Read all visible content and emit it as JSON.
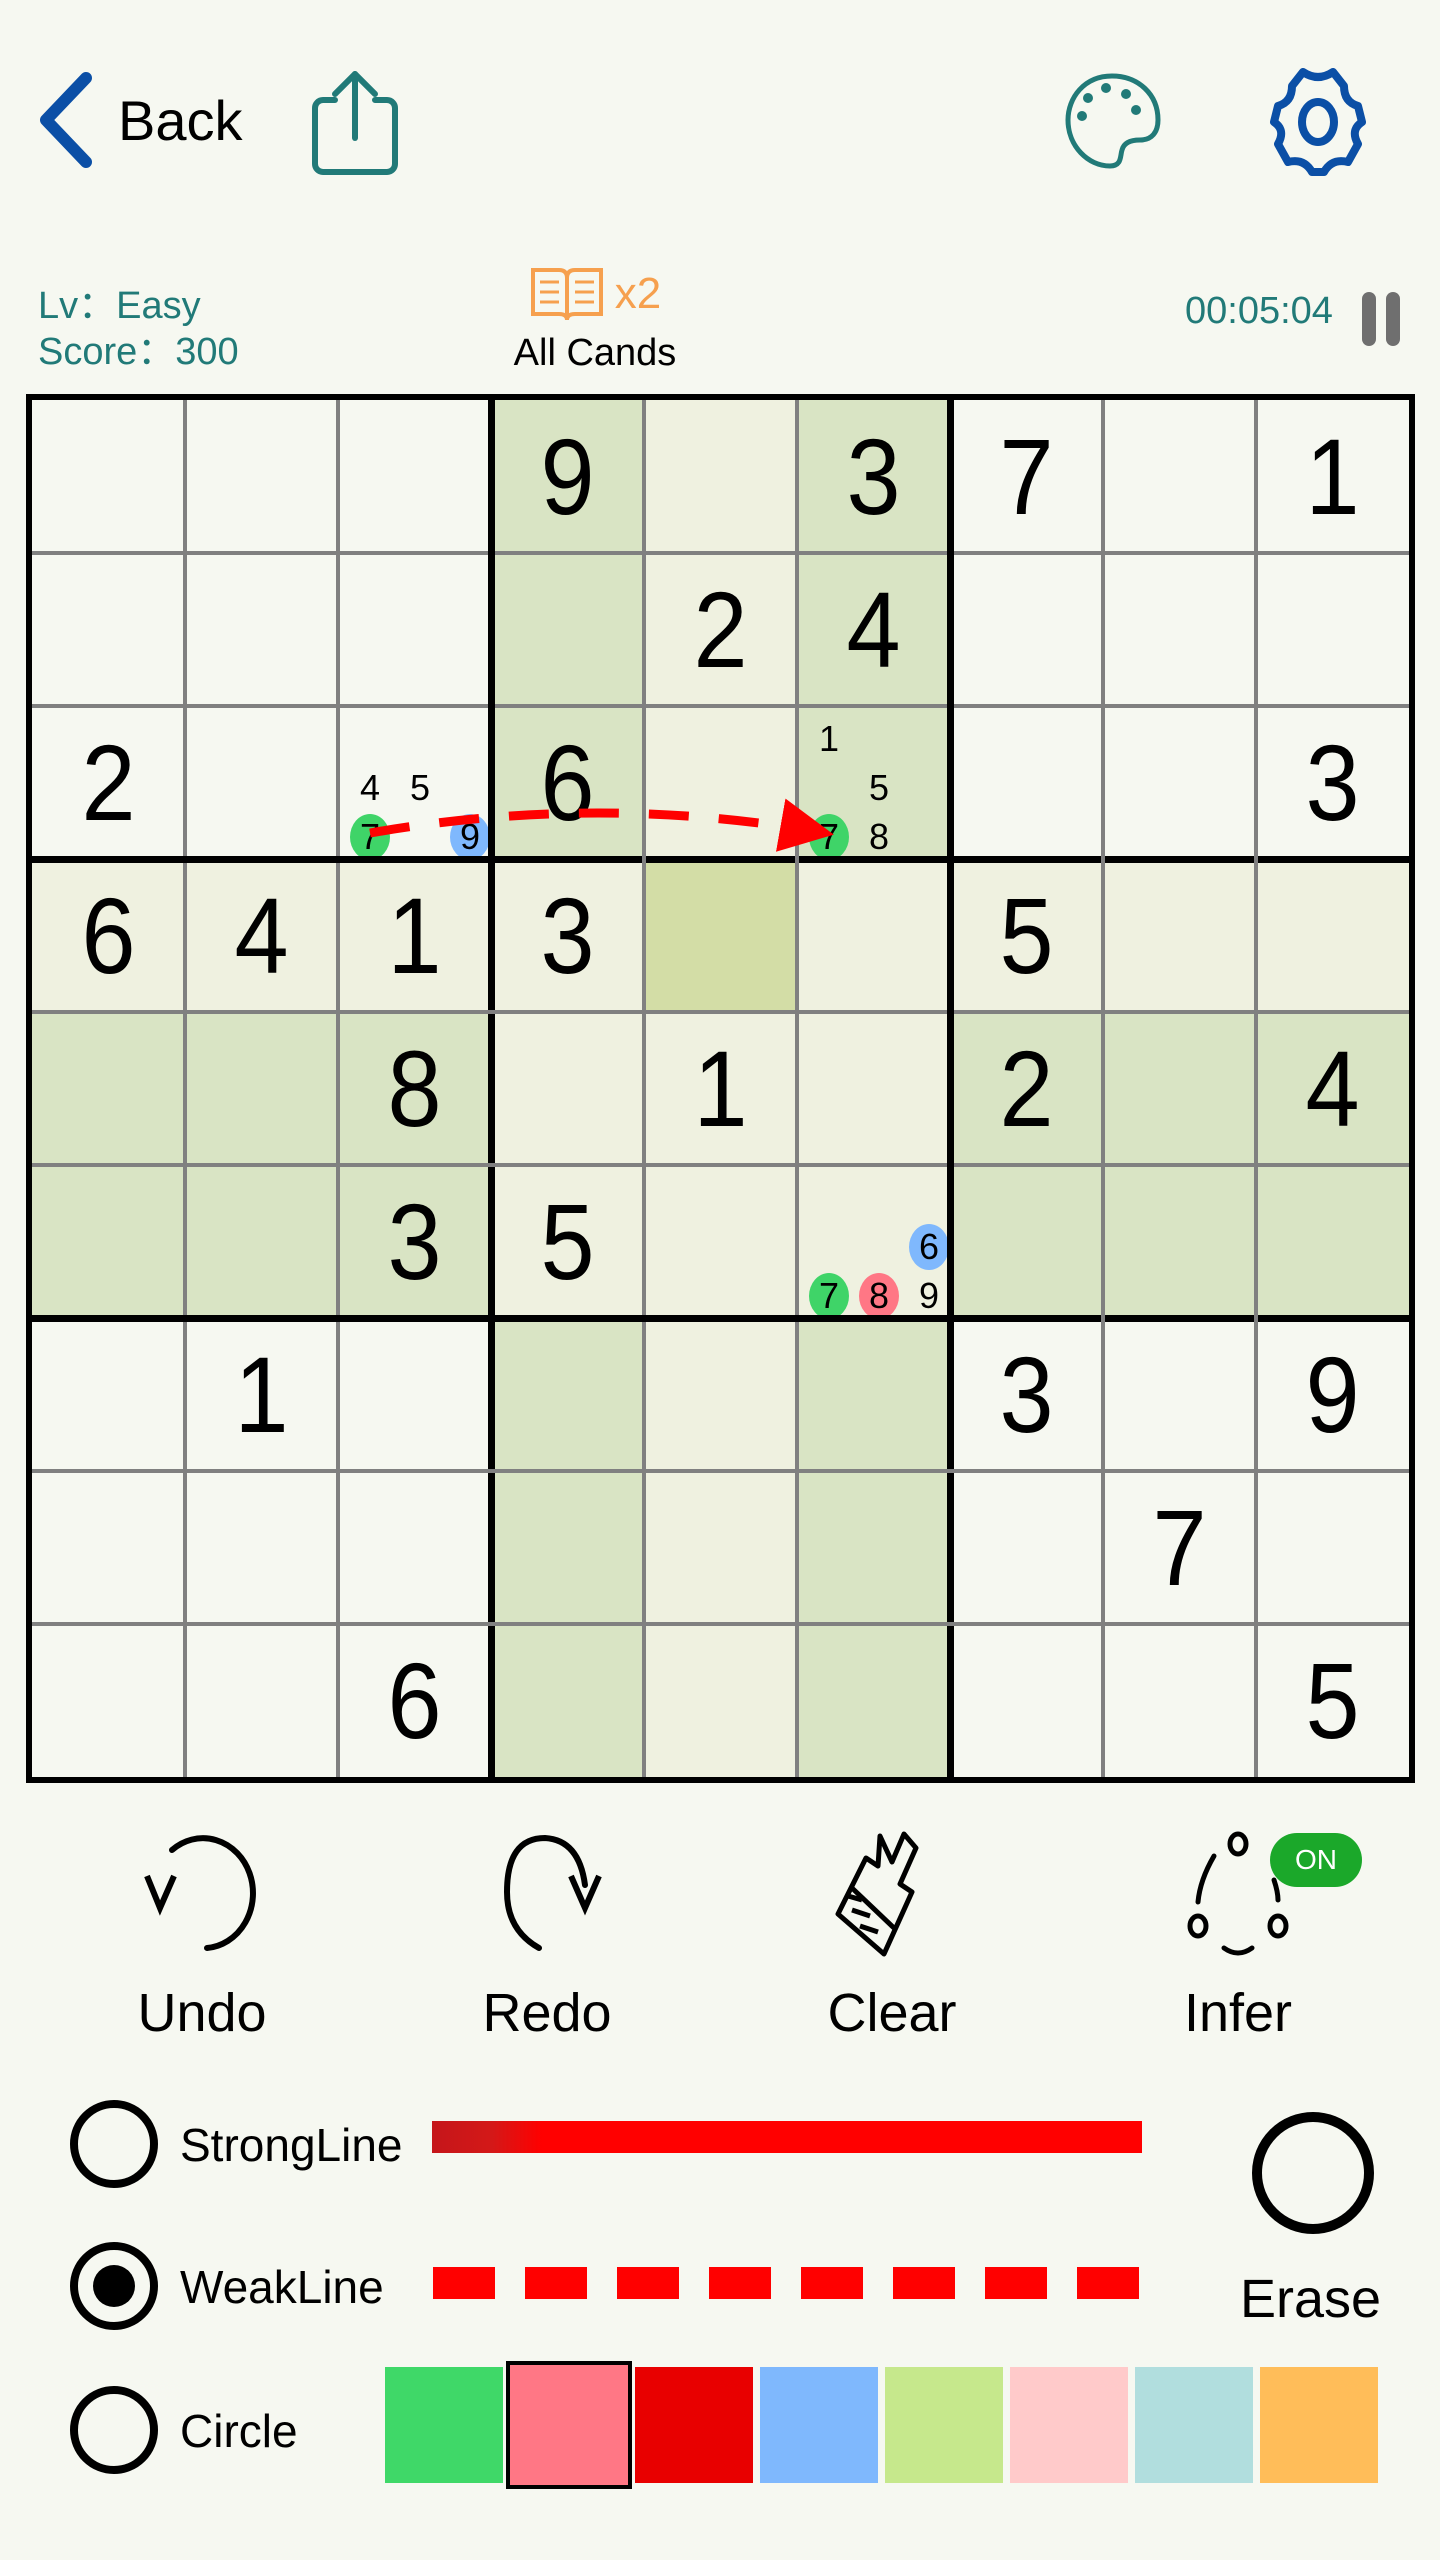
{
  "topbar": {
    "back_label": "Back",
    "icons": [
      "chevron-left-icon",
      "share-icon",
      "palette-icon",
      "gear-icon"
    ]
  },
  "info": {
    "level": "Lv：Easy",
    "score": "Score：300",
    "cands_multiplier": "x2",
    "cands_label": "All Cands",
    "timer": "00:05:04"
  },
  "colors": {
    "accent_teal": "#217a78",
    "accent_blue": "#0b4fa6",
    "cands_orange": "#f6a04e",
    "on_badge": "#1ba82a",
    "line_red": "#ff0000",
    "cell_white": "#f6f8f1",
    "cell_dark": "#d9e4c4",
    "cell_light": "#eff1e0",
    "cell_selected": "#d3dda6"
  },
  "board": {
    "givens": [
      [
        0,
        0,
        0,
        9,
        0,
        3,
        7,
        0,
        1
      ],
      [
        0,
        0,
        0,
        0,
        2,
        4,
        0,
        0,
        0
      ],
      [
        2,
        0,
        0,
        6,
        0,
        0,
        0,
        0,
        3
      ],
      [
        6,
        4,
        1,
        3,
        0,
        0,
        5,
        0,
        0
      ],
      [
        0,
        0,
        8,
        0,
        1,
        0,
        2,
        0,
        4
      ],
      [
        0,
        0,
        3,
        5,
        0,
        0,
        0,
        0,
        0
      ],
      [
        0,
        1,
        0,
        0,
        0,
        0,
        3,
        0,
        9
      ],
      [
        0,
        0,
        0,
        0,
        0,
        0,
        0,
        7,
        0
      ],
      [
        0,
        0,
        6,
        0,
        0,
        0,
        0,
        0,
        5
      ]
    ],
    "shading": [
      "wwwdldwww",
      "wwwdldwww",
      "wwwdldwww",
      "lllllllll",
      "dddllldddd",
      "dddllldddd",
      "wwwdldwww",
      "wwwdldwww",
      "wwwdldwww"
    ],
    "selected_cell": [
      3,
      4
    ],
    "candidates": [
      {
        "row": 2,
        "col": 2,
        "values": [
          {
            "n": 4,
            "color": null
          },
          {
            "n": 5,
            "color": null
          },
          {
            "n": 7,
            "color": "#3fd468"
          },
          {
            "n": 9,
            "color": "#7fb8fd"
          }
        ]
      },
      {
        "row": 2,
        "col": 5,
        "values": [
          {
            "n": 1,
            "color": null
          },
          {
            "n": 5,
            "color": null
          },
          {
            "n": 7,
            "color": "#3fd468"
          },
          {
            "n": 8,
            "color": null
          }
        ]
      },
      {
        "row": 5,
        "col": 5,
        "values": [
          {
            "n": 6,
            "color": "#7fb8fd"
          },
          {
            "n": 7,
            "color": "#3fd468"
          },
          {
            "n": 8,
            "color": "#ff7785"
          },
          {
            "n": 9,
            "color": null
          }
        ]
      }
    ],
    "links": [
      {
        "type": "weak",
        "from": {
          "row": 2,
          "col": 2,
          "n": 7
        },
        "to": {
          "row": 2,
          "col": 5,
          "n": 7
        },
        "color": "#ff0000",
        "arrow": true
      }
    ]
  },
  "tools": [
    {
      "id": "undo",
      "label": "Undo",
      "icon": "undo-icon"
    },
    {
      "id": "redo",
      "label": "Redo",
      "icon": "redo-icon"
    },
    {
      "id": "clear",
      "label": "Clear",
      "icon": "broom-icon"
    },
    {
      "id": "infer",
      "label": "Infer",
      "icon": "infer-icon",
      "badge": "ON"
    }
  ],
  "line_options": {
    "strong_label": "StrongLine",
    "weak_label": "WeakLine",
    "circle_label": "Circle",
    "selected": "WeakLine",
    "erase_label": "Erase"
  },
  "palette": {
    "selected_index": 1,
    "swatches": [
      "#3fd868",
      "#ff7785",
      "#e80000",
      "#7fb8fd",
      "#c6e88c",
      "#ffcaca",
      "#b1dede",
      "#ffbd59"
    ]
  }
}
